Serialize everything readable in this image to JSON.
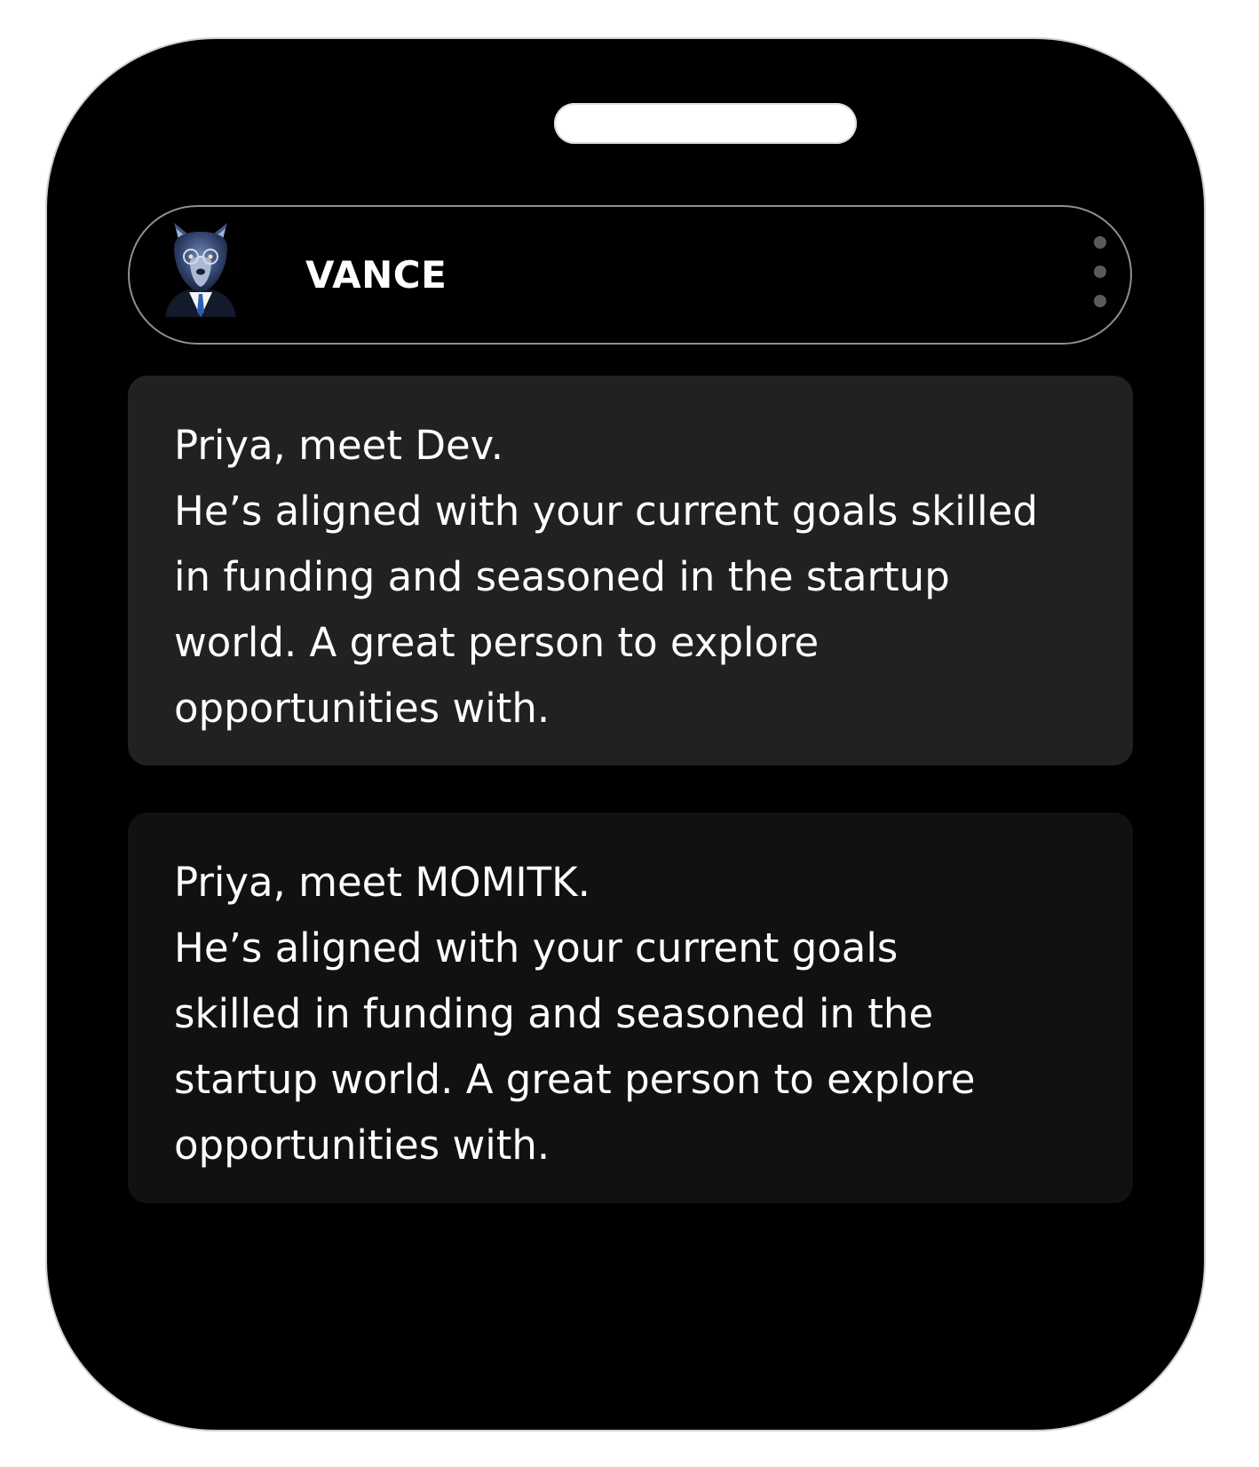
{
  "header": {
    "title": "VANCE",
    "avatar_icon": "wolf-in-suit-avatar-icon",
    "menu_icon": "more-vertical-icon"
  },
  "messages": [
    {
      "lines": [
        "Priya, meet Dev.",
        "He’s aligned with your current goals  skilled",
        "in funding and seasoned in the startup",
        "world. A great person to explore",
        "opportunities with."
      ]
    },
    {
      "lines": [
        "Priya, meet MOMITK.",
        "He’s aligned with your current goals",
        "skilled in funding and seasoned in the",
        "startup world. A great person to explore",
        "opportunities with."
      ]
    }
  ],
  "colors": {
    "device_background": "#000000",
    "card_primary": "#212121",
    "card_secondary": "#111111",
    "text": "#ffffff",
    "pill_border": "#8f8f8f"
  }
}
